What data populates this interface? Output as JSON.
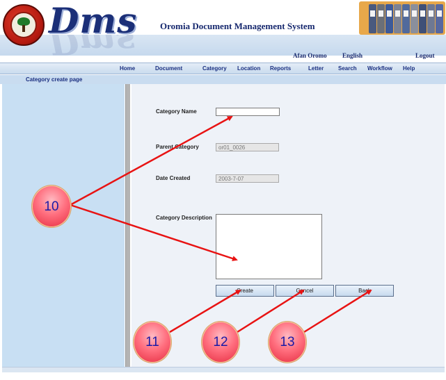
{
  "header": {
    "logo_text": "Dms",
    "app_title": "Oromia Document Management System",
    "languages": [
      "Afan Oromo",
      "English"
    ],
    "logout_label": "Logout",
    "binder_colors": [
      "#4a5a7e",
      "#6b6f78",
      "#3d5a99",
      "#7c8294",
      "#516a9c",
      "#8a8f9c",
      "#3f5077",
      "#6e7893",
      "#5768a0"
    ]
  },
  "nav": {
    "items": [
      "Home",
      "Document",
      "Category",
      "Location",
      "Reports",
      "Letter",
      "Search",
      "Workflow",
      "Help"
    ]
  },
  "breadcrumb": "Category create page",
  "form": {
    "category_name": {
      "label": "Category Name",
      "value": ""
    },
    "parent_category": {
      "label": "Parent Category",
      "value": "or01_0026"
    },
    "date_created": {
      "label": "Date Created",
      "value": "2003-7-07"
    },
    "description": {
      "label": "Category Description",
      "value": ""
    },
    "buttons": {
      "create": "Create",
      "cancel": "Cancel",
      "back": "Back"
    }
  },
  "callouts": [
    "10",
    "11",
    "12",
    "13"
  ],
  "colors": {
    "accent_blue": "#16286e",
    "sidebar": "#c8dff3",
    "arrow_red": "#e81313"
  }
}
